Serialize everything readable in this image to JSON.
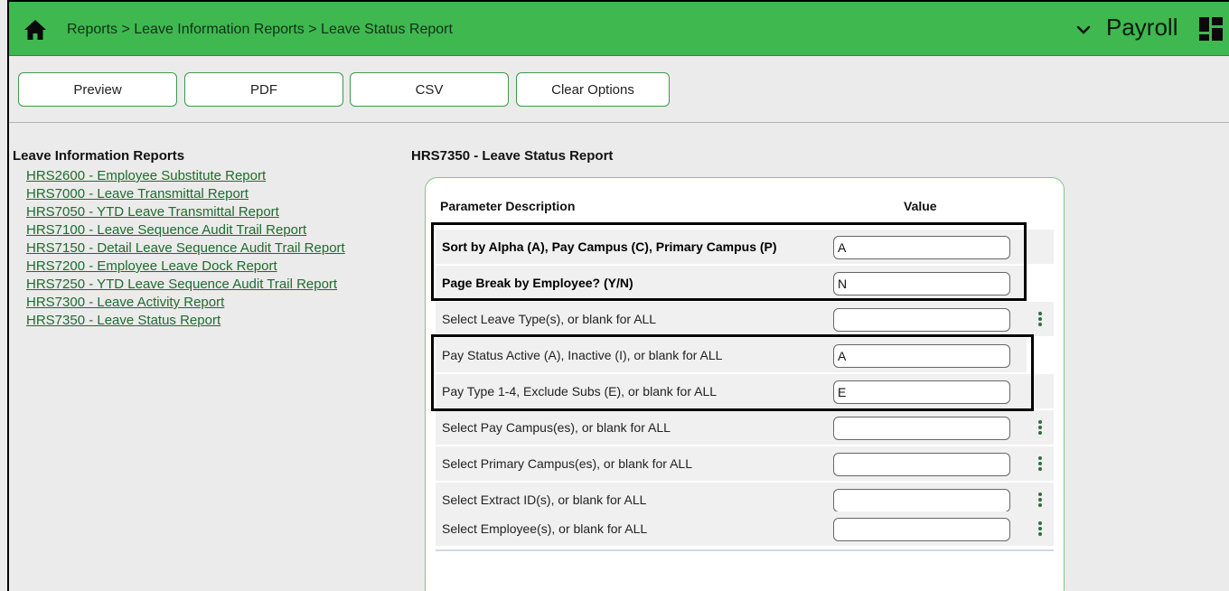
{
  "header": {
    "breadcrumb": "Reports > Leave Information Reports > Leave Status Report",
    "app_name": "Payroll",
    "bar_color": "#3fb84f",
    "icons": {
      "home": "home-icon",
      "menu_toggle": "chevron-down-icon",
      "apps": "grid-icon"
    }
  },
  "toolbar": {
    "preview_label": "Preview",
    "pdf_label": "PDF",
    "csv_label": "CSV",
    "clear_label": "Clear Options"
  },
  "sidebar": {
    "title": "Leave Information Reports",
    "items": [
      {
        "label": "HRS2600 - Employee Substitute Report"
      },
      {
        "label": "HRS7000 - Leave Transmittal Report"
      },
      {
        "label": "HRS7050 - YTD Leave Transmittal Report"
      },
      {
        "label": "HRS7100 - Leave Sequence Audit Trail Report"
      },
      {
        "label": "HRS7150 - Detail Leave Sequence Audit Trail Report"
      },
      {
        "label": "HRS7200 - Employee Leave Dock Report"
      },
      {
        "label": "HRS7250 - YTD Leave Sequence Audit Trail Report"
      },
      {
        "label": "HRS7300 - Leave Activity Report"
      },
      {
        "label": "HRS7350 - Leave Status Report"
      }
    ]
  },
  "main": {
    "report_title": "HRS7350 - Leave Status Report",
    "table": {
      "col_description": "Parameter Description",
      "col_value": "Value",
      "rows": [
        {
          "description": "Sort by Alpha (A), Pay Campus (C), Primary Campus (P)",
          "value": "A"
        },
        {
          "description": "Page Break by Employee? (Y/N)",
          "value": "N"
        },
        {
          "description": "Select Leave Type(s), or blank for ALL",
          "value": ""
        },
        {
          "description": "Pay Status Active (A), Inactive (I), or blank for ALL",
          "value": "A"
        },
        {
          "description": "Pay Type 1-4, Exclude Subs (E), or blank for ALL",
          "value": "E"
        },
        {
          "description": "Select Pay Campus(es), or blank for ALL",
          "value": ""
        },
        {
          "description": "Select Primary Campus(es), or blank for ALL",
          "value": ""
        },
        {
          "description": "Select Extract ID(s), or blank for ALL",
          "value": ""
        },
        {
          "description": "Select Employee(s), or blank for ALL",
          "value": ""
        }
      ]
    }
  }
}
